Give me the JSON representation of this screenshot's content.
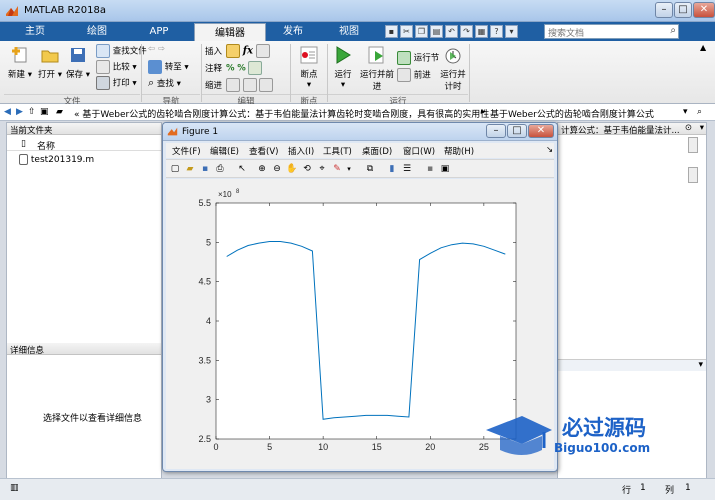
{
  "app": {
    "title": "MATLAB R2018a"
  },
  "window_buttons": {
    "minimize": "–",
    "maximize": "□",
    "close": "✕"
  },
  "tabs": [
    {
      "label": "主页"
    },
    {
      "label": "绘图"
    },
    {
      "label": "APP"
    },
    {
      "label": "编辑器"
    },
    {
      "label": "发布"
    },
    {
      "label": "视图"
    }
  ],
  "search": {
    "placeholder": "搜索文档"
  },
  "ribbon": {
    "new_label": "新建",
    "open_label": "打开",
    "save_label": "保存",
    "find_files_label": "查找文件",
    "compare_label": "比较",
    "print_label": "打印",
    "goto_label": "转至",
    "find_label": "查找",
    "insert_label": "插入",
    "comment_label": "注释",
    "indent_label": "缩进",
    "breakpoints_label": "断点",
    "run_label": "运行",
    "run_advance_label": "运行并前进",
    "run_section_label": "运行节",
    "advance_label": "前进",
    "run_time_label": "运行并计时",
    "groups": {
      "file": "文件",
      "navigate": "导航",
      "edit": "编辑",
      "breakpoints": "断点",
      "run": "运行"
    }
  },
  "address": {
    "path_main": "«  基于Weber公式的齿轮啮合刚度计算公式：基于韦伯能量法计算齿轮时变啮合刚度，具有很高的实用性",
    "path_last": "基于Weber公式的齿轮啮合刚度计算公式"
  },
  "left_panel": {
    "title": "当前文件夹",
    "col_name": "名称",
    "files": [
      "test201319.m"
    ],
    "details_title": "详细信息",
    "details_hint": "选择文件以查看详细信息"
  },
  "right_panel": {
    "title_fragment": "计算公式：基于韦伯能量法计..."
  },
  "figure": {
    "title": "Figure 1",
    "menus": [
      "文件(F)",
      "编辑(E)",
      "查看(V)",
      "插入(I)",
      "工具(T)",
      "桌面(D)",
      "窗口(W)",
      "帮助(H)"
    ],
    "exponent_label": "×10",
    "exponent_power": "8"
  },
  "chart_data": {
    "type": "line",
    "title": "",
    "xlabel": "",
    "ylabel": "",
    "xlim": [
      0,
      28
    ],
    "ylim": [
      2.5,
      5.5
    ],
    "xticks": [
      0,
      5,
      10,
      15,
      20,
      25
    ],
    "yticks": [
      2.5,
      3,
      3.5,
      4,
      4.5,
      5,
      5.5
    ],
    "y_multiplier": "1e8",
    "grid": false,
    "color": "#0072bd",
    "series": [
      {
        "x": [
          1,
          2,
          3,
          4,
          5,
          6,
          7,
          8,
          9,
          10,
          11,
          12,
          13,
          14,
          15,
          16,
          17,
          18,
          19,
          20,
          21,
          22,
          23,
          24,
          25,
          26,
          27
        ],
        "y": [
          4.82,
          4.9,
          4.96,
          4.99,
          5.01,
          5.01,
          4.99,
          4.95,
          4.89,
          2.75,
          2.77,
          2.78,
          2.79,
          2.8,
          2.8,
          2.8,
          2.79,
          2.78,
          4.78,
          4.86,
          4.93,
          4.97,
          4.99,
          4.98,
          4.95,
          4.9,
          4.85
        ]
      }
    ]
  },
  "status": {
    "row_label": "行",
    "row_value": "1",
    "col_label": "列",
    "col_value": "1"
  },
  "watermark": {
    "cn": "必过源码",
    "url": "Biguo100.com"
  }
}
